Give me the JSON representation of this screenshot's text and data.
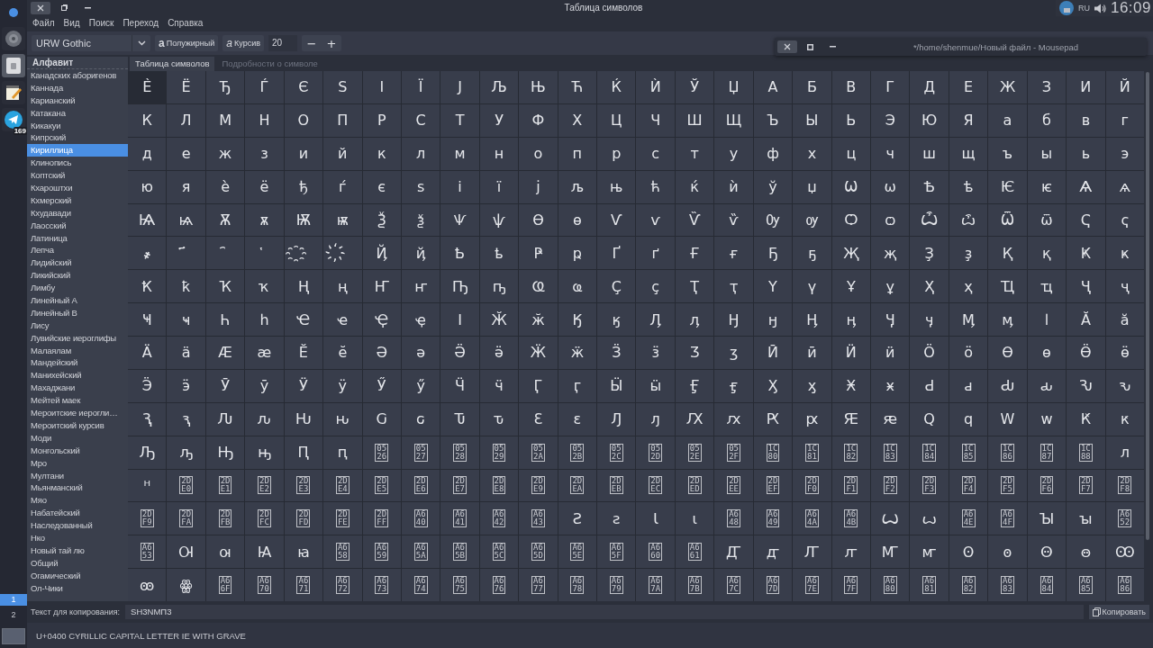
{
  "dock": {
    "apps": [
      {
        "kind": "launcher",
        "selected": false
      },
      {
        "kind": "disc",
        "selected": false
      },
      {
        "kind": "charmap",
        "selected": true
      },
      {
        "kind": "notepad",
        "selected": false
      },
      {
        "kind": "telegram",
        "selected": false,
        "badge": "169"
      }
    ],
    "workspaces": [
      {
        "label": "1",
        "selected": true
      },
      {
        "label": "2",
        "selected": false
      }
    ]
  },
  "window": {
    "title": "Таблица символов",
    "menu": [
      "Файл",
      "Вид",
      "Поиск",
      "Переход",
      "Справка"
    ]
  },
  "tray": {
    "language": "RU",
    "time": "16:09"
  },
  "toolbar": {
    "font": "URW Gothic",
    "bold": {
      "icon": "a",
      "label": "Полужирный"
    },
    "italic": {
      "icon": "a",
      "label": "Курсив"
    },
    "size": "20",
    "decrease": "−",
    "increase": "+"
  },
  "overlay_window": {
    "title": "*/home/shenmue/Новый файл - Mousepad"
  },
  "sidebar": {
    "heading": "Алфавит",
    "items": [
      {
        "label": "Канадских аборигенов",
        "selected": false
      },
      {
        "label": "Каннада",
        "selected": false
      },
      {
        "label": "Карианский",
        "selected": false
      },
      {
        "label": "Катакана",
        "selected": false
      },
      {
        "label": "Кикакуи",
        "selected": false
      },
      {
        "label": "Кипрский",
        "selected": false
      },
      {
        "label": "Кириллица",
        "selected": true
      },
      {
        "label": "Клинопись",
        "selected": false
      },
      {
        "label": "Коптский",
        "selected": false
      },
      {
        "label": "Кхароштхи",
        "selected": false
      },
      {
        "label": "Кхмерский",
        "selected": false
      },
      {
        "label": "Кхудавади",
        "selected": false
      },
      {
        "label": "Лаосский",
        "selected": false
      },
      {
        "label": "Латиница",
        "selected": false
      },
      {
        "label": "Лепча",
        "selected": false
      },
      {
        "label": "Лидийский",
        "selected": false
      },
      {
        "label": "Ликийский",
        "selected": false
      },
      {
        "label": "Лимбу",
        "selected": false
      },
      {
        "label": "Линейный А",
        "selected": false
      },
      {
        "label": "Линейный В",
        "selected": false
      },
      {
        "label": "Лису",
        "selected": false
      },
      {
        "label": "Лувийские иероглифы",
        "selected": false
      },
      {
        "label": "Малаялам",
        "selected": false
      },
      {
        "label": "Мандейский",
        "selected": false
      },
      {
        "label": "Манихейский",
        "selected": false
      },
      {
        "label": "Махаджани",
        "selected": false
      },
      {
        "label": "Мейтей маек",
        "selected": false
      },
      {
        "label": "Мероитские иерогли…",
        "selected": false
      },
      {
        "label": "Мероитский курсив",
        "selected": false
      },
      {
        "label": "Моди",
        "selected": false
      },
      {
        "label": "Монгольский",
        "selected": false
      },
      {
        "label": "Мро",
        "selected": false
      },
      {
        "label": "Мултани",
        "selected": false
      },
      {
        "label": "Мьянманский",
        "selected": false
      },
      {
        "label": "Мяо",
        "selected": false
      },
      {
        "label": "Набатейский",
        "selected": false
      },
      {
        "label": "Наследованный",
        "selected": false
      },
      {
        "label": "Нко",
        "selected": false
      },
      {
        "label": "Новый тай лю",
        "selected": false
      },
      {
        "label": "Общий",
        "selected": false
      },
      {
        "label": "Огамический",
        "selected": false
      },
      {
        "label": "Ол-Чики",
        "selected": false
      }
    ]
  },
  "tabs": [
    {
      "label": "Таблица символов",
      "selected": true
    },
    {
      "label": "Подробности о символе",
      "selected": false
    }
  ],
  "grid": {
    "rows": [
      [
        {
          "char": "Ѐ",
          "selected": true
        },
        "Ё",
        "Ђ",
        "Ѓ",
        "Є",
        "Ѕ",
        "І",
        "Ї",
        "Ј",
        "Љ",
        "Њ",
        "Ћ",
        "Ќ",
        "Ѝ",
        "Ў",
        "Џ",
        "А",
        "Б",
        "В",
        "Г",
        "Д",
        "Е",
        "Ж",
        "З",
        "И",
        "Й"
      ],
      [
        "К",
        "Л",
        "М",
        "Н",
        "О",
        "П",
        "Р",
        "С",
        "Т",
        "У",
        "Ф",
        "Х",
        "Ц",
        "Ч",
        "Ш",
        "Щ",
        "Ъ",
        "Ы",
        "Ь",
        "Э",
        "Ю",
        "Я",
        "а",
        "б",
        "в",
        "г"
      ],
      [
        "д",
        "е",
        "ж",
        "з",
        "и",
        "й",
        "к",
        "л",
        "м",
        "н",
        "о",
        "п",
        "р",
        "с",
        "т",
        "у",
        "ф",
        "х",
        "ц",
        "ч",
        "ш",
        "щ",
        "ъ",
        "ы",
        "ь",
        "э"
      ],
      [
        "ю",
        "я",
        "ѐ",
        "ё",
        "ђ",
        "ѓ",
        "є",
        "ѕ",
        "і",
        "ї",
        "ј",
        "љ",
        "њ",
        "ћ",
        "ќ",
        "ѝ",
        "ў",
        "џ",
        "Ѡ",
        "ѡ",
        "Ѣ",
        "ѣ",
        "Ѥ",
        "ѥ",
        "Ѧ",
        "ѧ"
      ],
      [
        "Ѩ",
        "ѩ",
        "Ѫ",
        "ѫ",
        "Ѭ",
        "ѭ",
        "Ѯ",
        "ѯ",
        "Ѱ",
        "ѱ",
        "Ѳ",
        "ѳ",
        "Ѵ",
        "ѵ",
        "Ѷ",
        "ѷ",
        "Ѹ",
        "ѹ",
        "Ѻ",
        "ѻ",
        "Ѽ",
        "ѽ",
        "Ѿ",
        "ѿ",
        "Ҁ",
        "ҁ"
      ],
      [
        "҂",
        "҃",
        "҄",
        "҅",
        "҈",
        "҉",
        "Ҋ",
        "ҋ",
        "Ҍ",
        "ҍ",
        "Ҏ",
        "ҏ",
        "Ґ",
        "ґ",
        "Ғ",
        "ғ",
        "Ҕ",
        "ҕ",
        "Җ",
        "җ",
        "Ҙ",
        "ҙ",
        "Қ",
        "қ",
        "Ҝ",
        "ҝ"
      ],
      [
        "Ҟ",
        "ҟ",
        "Ҡ",
        "ҡ",
        "Ң",
        "ң",
        "Ҥ",
        "ҥ",
        "Ҧ",
        "ҧ",
        "Ҩ",
        "ҩ",
        "Ҫ",
        "ҫ",
        "Ҭ",
        "ҭ",
        "Ү",
        "ү",
        "Ұ",
        "ұ",
        "Ҳ",
        "ҳ",
        "Ҵ",
        "ҵ",
        "Ҷ",
        "ҷ"
      ],
      [
        "Ҹ",
        "ҹ",
        "Һ",
        "һ",
        "Ҽ",
        "ҽ",
        "Ҿ",
        "ҿ",
        "Ӏ",
        "Ӂ",
        "ӂ",
        "Ӄ",
        "ӄ",
        "Ӆ",
        "ӆ",
        "Ӈ",
        "ӈ",
        "Ӊ",
        "ӊ",
        "Ӌ",
        "ӌ",
        "Ӎ",
        "ӎ",
        "ӏ",
        "Ӑ",
        "ӑ"
      ],
      [
        "Ӓ",
        "ӓ",
        "Ӕ",
        "ӕ",
        "Ӗ",
        "ӗ",
        "Ә",
        "ә",
        "Ӛ",
        "ӛ",
        "Ӝ",
        "ӝ",
        "Ӟ",
        "ӟ",
        "Ӡ",
        "ӡ",
        "Ӣ",
        "ӣ",
        "Ӥ",
        "ӥ",
        "Ӧ",
        "ӧ",
        "Ө",
        "ө",
        "Ӫ",
        "ӫ"
      ],
      [
        "Ӭ",
        "ӭ",
        "Ӯ",
        "ӯ",
        "Ӱ",
        "ӱ",
        "Ӳ",
        "ӳ",
        "Ӵ",
        "ӵ",
        "Ӷ",
        "ӷ",
        "Ӹ",
        "ӹ",
        "Ӻ",
        "ӻ",
        "Ӽ",
        "ӽ",
        "Ӿ",
        "ӿ",
        "Ԁ",
        "ԁ",
        "Ԃ",
        "ԃ",
        "Ԅ",
        "ԅ"
      ],
      [
        "Ԇ",
        "ԇ",
        "Ԉ",
        "ԉ",
        "Ԋ",
        "ԋ",
        "Ԍ",
        "ԍ",
        "Ԏ",
        "ԏ",
        "Ԑ",
        "ԑ",
        "Ԓ",
        "ԓ",
        "Ԕ",
        "ԕ",
        "Ԗ",
        "ԗ",
        "Ԙ",
        "ԙ",
        "Ԛ",
        "ԛ",
        "Ԝ",
        "ԝ",
        "Ԟ",
        "ԟ"
      ],
      [
        "Ԡ",
        "ԡ",
        "Ԣ",
        "ԣ",
        "Ԥ",
        "ԥ",
        {
          "code": "0526"
        },
        {
          "code": "0527"
        },
        {
          "code": "0528"
        },
        {
          "code": "0529"
        },
        {
          "code": "052A"
        },
        {
          "code": "052B"
        },
        {
          "code": "052C"
        },
        {
          "code": "052D"
        },
        {
          "code": "052E"
        },
        {
          "code": "052F"
        },
        {
          "code": "1C80"
        },
        {
          "code": "1C81"
        },
        {
          "code": "1C82"
        },
        {
          "code": "1C83"
        },
        {
          "code": "1C84"
        },
        {
          "code": "1C85"
        },
        {
          "code": "1C86"
        },
        {
          "code": "1C87"
        },
        {
          "code": "1C88"
        },
        "ᴫ"
      ],
      [
        "ᵸ",
        {
          "code": "2DE0"
        },
        {
          "code": "2DE1"
        },
        {
          "code": "2DE2"
        },
        {
          "code": "2DE3"
        },
        {
          "code": "2DE4"
        },
        {
          "code": "2DE5"
        },
        {
          "code": "2DE6"
        },
        {
          "code": "2DE7"
        },
        {
          "code": "2DE8"
        },
        {
          "code": "2DE9"
        },
        {
          "code": "2DEA"
        },
        {
          "code": "2DEB"
        },
        {
          "code": "2DEC"
        },
        {
          "code": "2DED"
        },
        {
          "code": "2DEE"
        },
        {
          "code": "2DEF"
        },
        {
          "code": "2DF0"
        },
        {
          "code": "2DF1"
        },
        {
          "code": "2DF2"
        },
        {
          "code": "2DF3"
        },
        {
          "code": "2DF4"
        },
        {
          "code": "2DF5"
        },
        {
          "code": "2DF6"
        },
        {
          "code": "2DF7"
        },
        {
          "code": "2DF8"
        }
      ],
      [
        {
          "code": "2DF9"
        },
        {
          "code": "2DFA"
        },
        {
          "code": "2DFB"
        },
        {
          "code": "2DFC"
        },
        {
          "code": "2DFD"
        },
        {
          "code": "2DFE"
        },
        {
          "code": "2DFF"
        },
        {
          "code": "A640"
        },
        {
          "code": "A641"
        },
        {
          "code": "A642"
        },
        {
          "code": "A643"
        },
        "Ꙅ",
        "ꙅ",
        "Ꙇ",
        "ꙇ",
        {
          "code": "A648"
        },
        {
          "code": "A649"
        },
        {
          "code": "A64A"
        },
        {
          "code": "A64B"
        },
        "Ꙍ",
        "ꙍ",
        {
          "code": "A64E"
        },
        {
          "code": "A64F"
        },
        "Ꙑ",
        "ꙑ",
        {
          "code": "A652"
        }
      ],
      [
        {
          "code": "A653"
        },
        "Ꙕ",
        "ꙕ",
        "Ꙗ",
        "ꙗ",
        {
          "code": "A658"
        },
        {
          "code": "A659"
        },
        {
          "code": "A65A"
        },
        {
          "code": "A65B"
        },
        {
          "code": "A65C"
        },
        {
          "code": "A65D"
        },
        {
          "code": "A65E"
        },
        {
          "code": "A65F"
        },
        {
          "code": "A660"
        },
        {
          "code": "A661"
        },
        "Ꙣ",
        "ꙣ",
        "Ꙥ",
        "ꙥ",
        "Ꙧ",
        "ꙧ",
        "Ꙩ",
        "ꙩ",
        "Ꙫ",
        "ꙫ",
        "Ꙭ"
      ],
      [
        "ꙭ",
        "ꙮ",
        {
          "code": "A66F"
        },
        {
          "code": "A670"
        },
        {
          "code": "A671"
        },
        {
          "code": "A672"
        },
        {
          "code": "A673"
        },
        {
          "code": "A674"
        },
        {
          "code": "A675"
        },
        {
          "code": "A676"
        },
        {
          "code": "A677"
        },
        {
          "code": "A678"
        },
        {
          "code": "A679"
        },
        {
          "code": "A67A"
        },
        {
          "code": "A67B"
        },
        {
          "code": "A67C"
        },
        {
          "code": "A67D"
        },
        {
          "code": "A67E"
        },
        {
          "code": "A67F"
        },
        {
          "code": "A680"
        },
        {
          "code": "A681"
        },
        {
          "code": "A682"
        },
        {
          "code": "A683"
        },
        {
          "code": "A684"
        },
        {
          "code": "A685"
        },
        {
          "code": "A686"
        }
      ]
    ]
  },
  "copy_bar": {
    "label": "Текст для копирования:",
    "value": "SH3NMП3",
    "button": "Копировать"
  },
  "status_bar": {
    "text": "U+0400 CYRILLIC CAPITAL LETTER IE WITH GRAVE"
  }
}
